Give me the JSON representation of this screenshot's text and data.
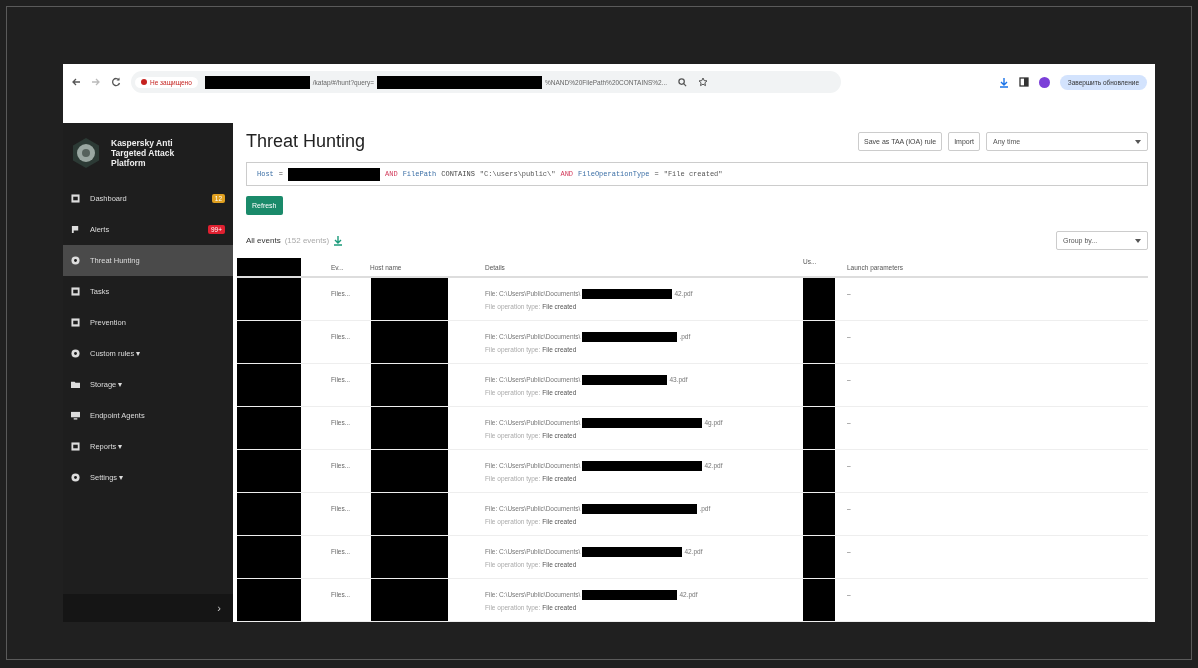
{
  "browser": {
    "security": "Не защищено",
    "url_parts": [
      "/katap/#/hunt?query=",
      "%NAND%20FilePath%20CONTAINS%2..."
    ],
    "update_button": "Завершить обновление"
  },
  "sidebar": {
    "product": "Kaspersky Anti Targeted Attack Platform",
    "items": [
      {
        "label": "Dashboard",
        "kind": "page",
        "badge": "12",
        "color": "#e0a020",
        "selected": false
      },
      {
        "label": "Alerts",
        "kind": "flag",
        "badge": "99+",
        "color": "#e02030",
        "selected": false
      },
      {
        "label": "Threat Hunting",
        "kind": "round",
        "selected": true
      },
      {
        "label": "Tasks",
        "kind": "page",
        "selected": false
      },
      {
        "label": "Prevention",
        "kind": "page",
        "selected": false
      },
      {
        "label": "Custom rules ▾",
        "kind": "round",
        "selected": false
      },
      {
        "label": "Storage ▾",
        "kind": "folder",
        "selected": false
      },
      {
        "label": "Endpoint Agents",
        "kind": "monitor",
        "selected": false
      },
      {
        "label": "Reports ▾",
        "kind": "page",
        "selected": false
      },
      {
        "label": "Settings ▾",
        "kind": "round",
        "selected": false
      }
    ],
    "collapse": "›"
  },
  "page": {
    "title": "Threat Hunting",
    "actions": [
      "Save as TAA (IOA) rule",
      "Import"
    ],
    "period": "Any time",
    "query": [
      {
        "kind": "field",
        "text": "Host"
      },
      {
        "kind": "op",
        "text": "="
      },
      {
        "kind": "redacted"
      },
      {
        "kind": "keyword",
        "text": "AND"
      },
      {
        "kind": "field",
        "text": "FilePath"
      },
      {
        "kind": "op",
        "text": "CONTAINS"
      },
      {
        "kind": "string",
        "text": "\"C:\\users\\public\\\""
      },
      {
        "kind": "keyword",
        "text": "AND"
      },
      {
        "kind": "field",
        "text": "FileOperationType"
      },
      {
        "kind": "op",
        "text": "="
      },
      {
        "kind": "string",
        "text": "\"File created\""
      }
    ],
    "refresh": "Refresh",
    "events_label": "All events",
    "events_count": "(152 events)",
    "group_by": "Group by..."
  },
  "table": {
    "columns": [
      "Ev...",
      "Host name",
      "Details",
      "Us...",
      "Launch parameters"
    ],
    "rows": [
      {
        "event": "Files...",
        "file_label": "File:",
        "path": "C:\\Users\\Public\\Documents\\",
        "suffix": "42.pdf",
        "op_label": "File operation type:",
        "op_value": "File created",
        "launch": "–"
      },
      {
        "event": "Files...",
        "file_label": "File:",
        "path": "C:\\Users\\Public\\Documents\\",
        "suffix": ".pdf",
        "op_label": "File operation type:",
        "op_value": "File created",
        "launch": "–"
      },
      {
        "event": "Files...",
        "file_label": "File:",
        "path": "C:\\Users\\Public\\Documents\\",
        "suffix": "43.pdf",
        "op_label": "File operation type:",
        "op_value": "File created",
        "launch": "–"
      },
      {
        "event": "Files...",
        "file_label": "File:",
        "path": "C:\\Users\\Public\\Documents\\",
        "suffix": "4g.pdf",
        "op_label": "File operation type:",
        "op_value": "File created",
        "launch": "–"
      },
      {
        "event": "Files...",
        "file_label": "File:",
        "path": "C:\\Users\\Public\\Documents\\",
        "suffix": "42.pdf",
        "op_label": "File operation type:",
        "op_value": "File created",
        "launch": "–"
      },
      {
        "event": "Files...",
        "file_label": "File:",
        "path": "C:\\Users\\Public\\Documents\\",
        "suffix": ".pdf",
        "op_label": "File operation type:",
        "op_value": "File created",
        "launch": "–"
      },
      {
        "event": "Files...",
        "file_label": "File:",
        "path": "C:\\Users\\Public\\Documents\\",
        "suffix": "42.pdf",
        "op_label": "File operation type:",
        "op_value": "File created",
        "launch": "–"
      },
      {
        "event": "Files...",
        "file_label": "File:",
        "path": "C:\\Users\\Public\\Documents\\",
        "suffix": "42.pdf",
        "op_label": "File operation type:",
        "op_value": "File created",
        "launch": "–"
      }
    ]
  }
}
